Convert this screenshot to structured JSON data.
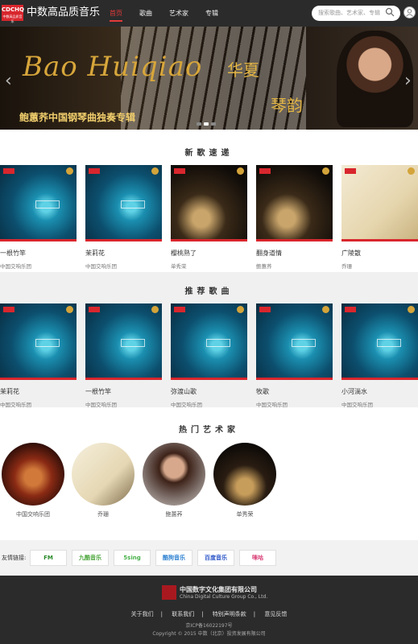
{
  "header": {
    "logo_text": "CDCHQ",
    "logo_sub": "中数高品质音乐",
    "brand": "中数高品质音乐",
    "nav": [
      "首页",
      "歌曲",
      "艺术家",
      "专辑"
    ],
    "search_placeholder": "搜索歌曲、艺术家、专辑"
  },
  "banner": {
    "script_title": "Bao Huiqiao",
    "cn_title_1": "华夏",
    "cn_title_2": "琴韵",
    "subtitle": "鲍蕙荞中国钢琴曲独奏专辑"
  },
  "new_songs": {
    "title": "新歌速递",
    "items": [
      {
        "title": "一根竹竿",
        "artist": "中国交响乐团",
        "style": "blue"
      },
      {
        "title": "茉莉花",
        "artist": "中国交响乐团",
        "style": "blue"
      },
      {
        "title": "樱桃熟了",
        "artist": "单秀荣",
        "style": "dark"
      },
      {
        "title": "翻身道情",
        "artist": "鲍蕙荞",
        "style": "dark"
      },
      {
        "title": "广陵散",
        "artist": "乔珊",
        "style": "cream"
      }
    ]
  },
  "recommended": {
    "title": "推荐歌曲",
    "items": [
      {
        "title": "茉莉花",
        "artist": "中国交响乐团"
      },
      {
        "title": "一根竹竿",
        "artist": "中国交响乐团"
      },
      {
        "title": "弥渡山歌",
        "artist": "中国交响乐团"
      },
      {
        "title": "牧歌",
        "artist": "中国交响乐团"
      },
      {
        "title": "小河淌水",
        "artist": "中国交响乐团"
      }
    ]
  },
  "artists": {
    "title": "热门艺术家",
    "items": [
      "中国交响乐团",
      "乔珊",
      "鲍蕙荞",
      "单秀荣"
    ]
  },
  "links": {
    "label": "友情链接:",
    "items": [
      "FM",
      "九酷音乐",
      "5sing",
      "酷狗音乐",
      "百度音乐",
      "咪咕"
    ]
  },
  "footer": {
    "company_cn": "中国数字文化集团有限公司",
    "company_en": "China Digital Culture Group Co., Ltd.",
    "nav": [
      "关于我们",
      "联系我们",
      "特别声明条款",
      "意见反馈"
    ],
    "icp": "京ICP备16022197号",
    "copyright": "Copyright © 2015 中数（北京）投资发展有限公司"
  }
}
